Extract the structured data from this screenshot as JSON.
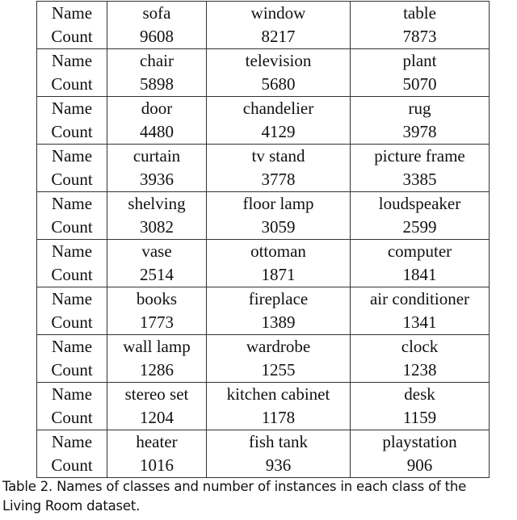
{
  "table": {
    "row_labels": {
      "name": "Name",
      "count": "Count"
    },
    "groups": [
      {
        "items": [
          {
            "name": "sofa",
            "count": "9608"
          },
          {
            "name": "window",
            "count": "8217"
          },
          {
            "name": "table",
            "count": "7873"
          }
        ]
      },
      {
        "items": [
          {
            "name": "chair",
            "count": "5898"
          },
          {
            "name": "television",
            "count": "5680"
          },
          {
            "name": "plant",
            "count": "5070"
          }
        ]
      },
      {
        "items": [
          {
            "name": "door",
            "count": "4480"
          },
          {
            "name": "chandelier",
            "count": "4129"
          },
          {
            "name": "rug",
            "count": "3978"
          }
        ]
      },
      {
        "items": [
          {
            "name": "curtain",
            "count": "3936"
          },
          {
            "name": "tv stand",
            "count": "3778"
          },
          {
            "name": "picture frame",
            "count": "3385"
          }
        ]
      },
      {
        "items": [
          {
            "name": "shelving",
            "count": "3082"
          },
          {
            "name": "floor lamp",
            "count": "3059"
          },
          {
            "name": "loudspeaker",
            "count": "2599"
          }
        ]
      },
      {
        "items": [
          {
            "name": "vase",
            "count": "2514"
          },
          {
            "name": "ottoman",
            "count": "1871"
          },
          {
            "name": "computer",
            "count": "1841"
          }
        ]
      },
      {
        "items": [
          {
            "name": "books",
            "count": "1773"
          },
          {
            "name": "fireplace",
            "count": "1389"
          },
          {
            "name": "air conditioner",
            "count": "1341"
          }
        ]
      },
      {
        "items": [
          {
            "name": "wall lamp",
            "count": "1286"
          },
          {
            "name": "wardrobe",
            "count": "1255"
          },
          {
            "name": "clock",
            "count": "1238"
          }
        ]
      },
      {
        "items": [
          {
            "name": "stereo set",
            "count": "1204"
          },
          {
            "name": "kitchen cabinet",
            "count": "1178"
          },
          {
            "name": "desk",
            "count": "1159"
          }
        ]
      },
      {
        "items": [
          {
            "name": "heater",
            "count": "1016"
          },
          {
            "name": "fish tank",
            "count": "936"
          },
          {
            "name": "playstation",
            "count": "906"
          }
        ]
      }
    ]
  },
  "caption": {
    "line1": "Table 2.  Names of classes and number of instances in each class of the",
    "line2": "Living Room dataset."
  }
}
